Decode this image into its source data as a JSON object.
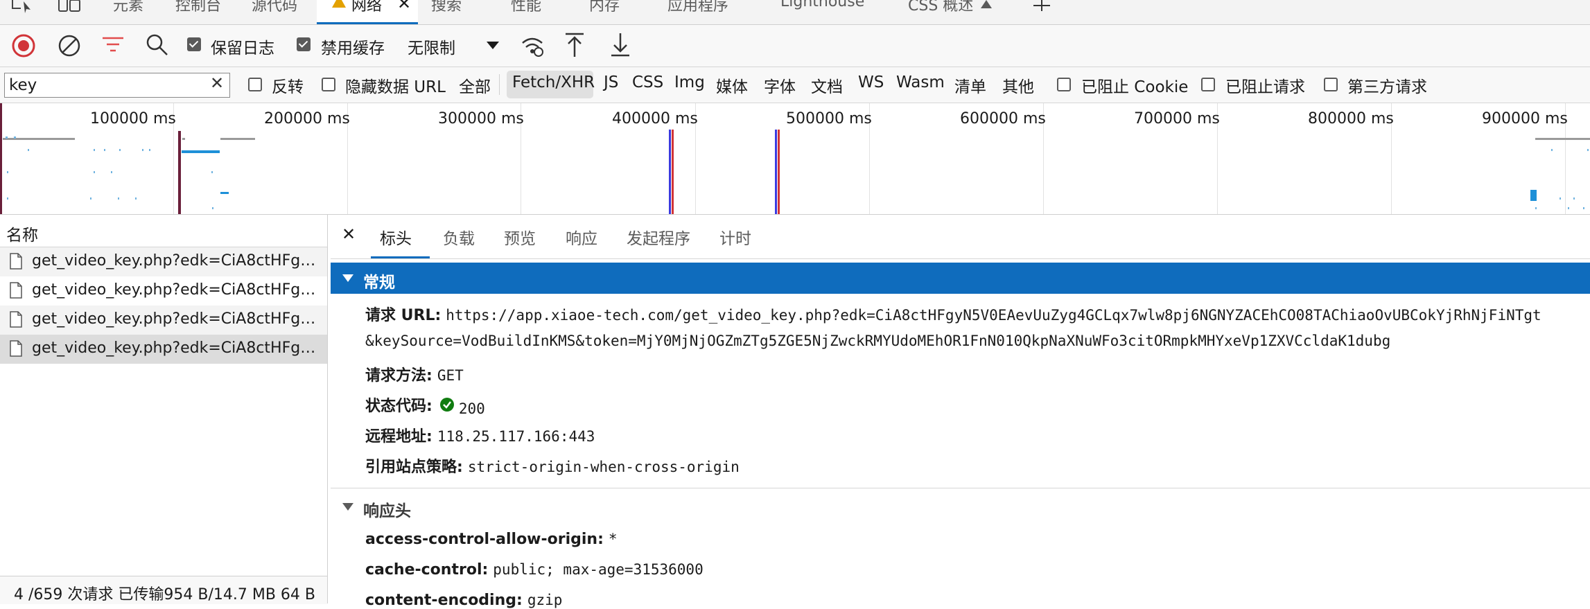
{
  "top_tabs": [
    {
      "label": "元素"
    },
    {
      "label": "控制台"
    },
    {
      "label": "源代码"
    },
    {
      "label": "网络"
    },
    {
      "label": "搜索"
    },
    {
      "label": "性能"
    },
    {
      "label": "内存"
    },
    {
      "label": "应用程序"
    },
    {
      "label": "Lighthouse"
    },
    {
      "label": "CSS 概述"
    }
  ],
  "toolbar": {
    "preserve_log": {
      "label": "保留日志",
      "checked": true
    },
    "disable_cache": {
      "label": "禁用缓存",
      "checked": true
    },
    "throttling": "无限制"
  },
  "filter": {
    "value": "key",
    "invert_label": "反转",
    "hide_data_urls_label": "隐藏数据 URL",
    "types": [
      "全部",
      "Fetch/XHR",
      "JS",
      "CSS",
      "Img",
      "媒体",
      "字体",
      "文档",
      "WS",
      "Wasm",
      "清单",
      "其他"
    ],
    "active_type": "Fetch/XHR",
    "blocked_cookies_label": "已阻止 Cookie",
    "blocked_requests_label": "已阻止请求",
    "third_party_label": "第三方请求"
  },
  "overview": {
    "ticks": [
      "100000 ms",
      "200000 ms",
      "300000 ms",
      "400000 ms",
      "500000 ms",
      "600000 ms",
      "700000 ms",
      "800000 ms",
      "900000 ms"
    ]
  },
  "requests": {
    "header": "名称",
    "rows": [
      {
        "name": "get_video_key.php?edk=CiA8ctHFgy..."
      },
      {
        "name": "get_video_key.php?edk=CiA8ctHFgy..."
      },
      {
        "name": "get_video_key.php?edk=CiA8ctHFgy..."
      },
      {
        "name": "get_video_key.php?edk=CiA8ctHFgy..."
      }
    ],
    "selected_index": 3,
    "status": "4 /659 次请求  已传输954 B/14.7 MB  64 B"
  },
  "detail": {
    "tabs": [
      "标头",
      "负载",
      "预览",
      "响应",
      "发起程序",
      "计时"
    ],
    "active_tab": "标头",
    "general": {
      "title": "常规",
      "request_url_key": "请求 URL:",
      "request_url_line1": "https://app.xiaoe-tech.com/get_video_key.php?edk=CiA8ctHFgyN5V0EAevUuZyg4GCLqx7wlw8pj6NGNYZACEhCO08TAChiaoOvUBCokYjRhNjFiNTgt",
      "request_url_line2": "&keySource=VodBuildInKMS&token=MjY0MjNjOGZmZTg5ZGE5NjZwckRMYUdoMEhOR1FnN010QkpNaXNuWFo3citORmpkMHYxeVp1ZXVCcldaK1dubg",
      "method_key": "请求方法:",
      "method": "GET",
      "status_key": "状态代码:",
      "status": "200",
      "remote_key": "远程地址:",
      "remote": "118.25.117.166:443",
      "referrer_key": "引用站点策略:",
      "referrer": "strict-origin-when-cross-origin"
    },
    "response_headers": {
      "title": "响应头",
      "items": [
        {
          "key": "access-control-allow-origin:",
          "value": "*"
        },
        {
          "key": "cache-control:",
          "value": "public; max-age=31536000"
        },
        {
          "key": "content-encoding:",
          "value": "gzip"
        }
      ]
    }
  },
  "colors": {
    "accent": "#0f6cbd",
    "record_red": "#d13438",
    "filter_red": "#e24d4d",
    "status_green": "#107c10",
    "warning": "#e3a100"
  }
}
